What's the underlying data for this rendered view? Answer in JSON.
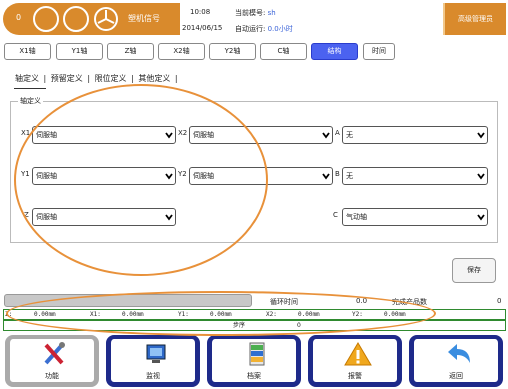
{
  "header": {
    "counter": "0",
    "signal_label": "塑机信号",
    "time": "10:08",
    "date": "2014/06/15",
    "mold_label": "当前模号:",
    "mold_value": "sh",
    "auto_label": "自动运行:",
    "auto_value": "0.0小时",
    "admin_label": "高级管理员"
  },
  "tabs": [
    "X1轴",
    "Y1轴",
    "Z轴",
    "X2轴",
    "Y2轴",
    "C轴",
    "结构",
    "时间"
  ],
  "active_tab": "结构",
  "subtabs": [
    "轴定义",
    "预留定义",
    "限位定义",
    "其他定义"
  ],
  "group_title": "轴定义",
  "axes": {
    "x1": {
      "label": "X1",
      "value": "伺服轴"
    },
    "x2": {
      "label": "X2",
      "value": "伺服轴"
    },
    "a": {
      "label": "A",
      "value": "无"
    },
    "y1": {
      "label": "Y1",
      "value": "伺服轴"
    },
    "y2": {
      "label": "Y2",
      "value": "伺服轴"
    },
    "b": {
      "label": "B",
      "value": "无"
    },
    "z": {
      "label": "Z",
      "value": "伺服轴"
    },
    "c": {
      "label": "C",
      "value": "气动轴"
    }
  },
  "save_label": "保存",
  "status": {
    "cycle_label": "循环时间",
    "cycle_value": "0.0",
    "product_label": "完成产品数",
    "product_value": "0",
    "coords": [
      {
        "label": "Z:",
        "value": "0.00mm"
      },
      {
        "label": "X1:",
        "value": "0.00mm"
      },
      {
        "label": "Y1:",
        "value": "0.00mm"
      },
      {
        "label": "X2:",
        "value": "0.00mm"
      },
      {
        "label": "Y2:",
        "value": "0.00mm"
      }
    ],
    "step_label": "步序",
    "step_value": "0"
  },
  "nav": [
    {
      "label": "功能",
      "icon": "tools-icon"
    },
    {
      "label": "监视",
      "icon": "monitor-icon"
    },
    {
      "label": "档案",
      "icon": "file-cabinet-icon"
    },
    {
      "label": "报警",
      "icon": "warning-icon"
    },
    {
      "label": "返回",
      "icon": "back-arrow-icon"
    }
  ],
  "colors": {
    "accent": "#d98a2c",
    "tab_active": "#4b62f0",
    "nav_border": "#1e2a8a",
    "annotation": "#e8913a"
  }
}
